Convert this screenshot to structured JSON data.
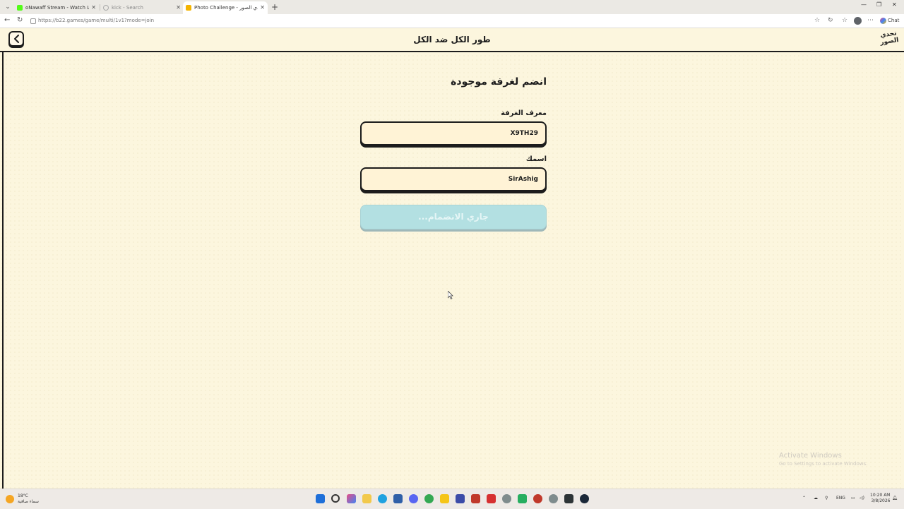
{
  "browser": {
    "tabs": [
      {
        "label": "oNawaff Stream - Watch Live on K"
      },
      {
        "label": "kick - Search"
      },
      {
        "label": "Photo Challenge - لعبة تحدي الصور"
      }
    ],
    "url": "https://b22.games/game/multi/1v1?mode=join",
    "chat_label": "Chat"
  },
  "header": {
    "title": "طور الكل ضد الكل",
    "logo_text": "تحدي الصور"
  },
  "form": {
    "heading": "انضم لغرفة موجودة",
    "room_label": "معرف الغرفة",
    "room_value": "X9TH29",
    "name_label": "اسمك",
    "name_value": "SirAshig",
    "join_button": "جاري الانضمام..."
  },
  "watermark": {
    "line1": "Activate Windows",
    "line2": "Go to Settings to activate Windows."
  },
  "taskbar": {
    "temperature": "18°C",
    "weather": "سماء صافية",
    "language": "ENG",
    "time": "10:20 AM",
    "date": "3/8/2026"
  }
}
